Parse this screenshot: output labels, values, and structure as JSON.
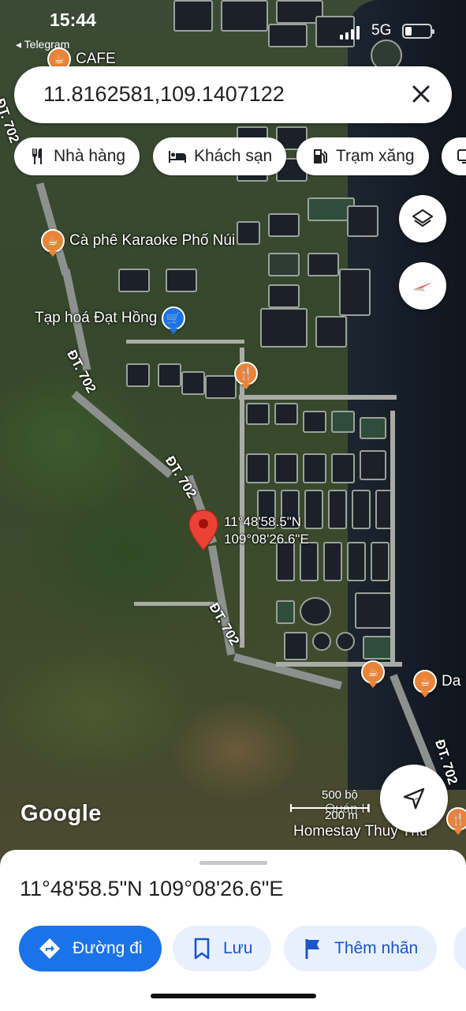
{
  "status_bar": {
    "time": "15:44",
    "back_app": "◂ Telegram",
    "network": "5G"
  },
  "search": {
    "query": "11.8162581,109.1407122"
  },
  "chips": [
    {
      "label": "Nhà hàng",
      "icon": "restaurant-icon"
    },
    {
      "label": "Khách sạn",
      "icon": "hotel-icon"
    },
    {
      "label": "Trạm xăng",
      "icon": "gas-station-icon"
    }
  ],
  "map": {
    "pois": [
      {
        "label": "CAFE",
        "type": "cafe"
      },
      {
        "label": "Cà phê Karaoke Phố Núi",
        "type": "cafe"
      },
      {
        "label": "Tạp hoá Đạt Hồng",
        "type": "shopping"
      },
      {
        "label": "",
        "type": "restaurant"
      },
      {
        "label": "",
        "type": "cafe"
      },
      {
        "label": "Da",
        "type": "cafe"
      },
      {
        "label": "Homestay Thuỳ Thủ",
        "type": "restaurant"
      }
    ],
    "road_labels": [
      "ĐT. 702",
      "ĐT. 702",
      "ĐT. 702",
      "ĐT. 702",
      "ĐT. 702"
    ],
    "pin": {
      "lat_dms": "11°48'58.5\"N",
      "lng_dms": "109°08'26.6\"E"
    },
    "attribution": "Google",
    "scale": {
      "top": "500 bộ",
      "bottom": "200 m"
    },
    "partial_label": "Quán H"
  },
  "sheet": {
    "title": "11°48'58.5\"N 109°08'26.6\"E",
    "actions": {
      "directions": "Đường đi",
      "save": "Lưu",
      "label": "Thêm nhãn"
    }
  },
  "colors": {
    "primary": "#1a73e8",
    "poi_orange": "#e8843a",
    "pin_red": "#ea4335"
  }
}
